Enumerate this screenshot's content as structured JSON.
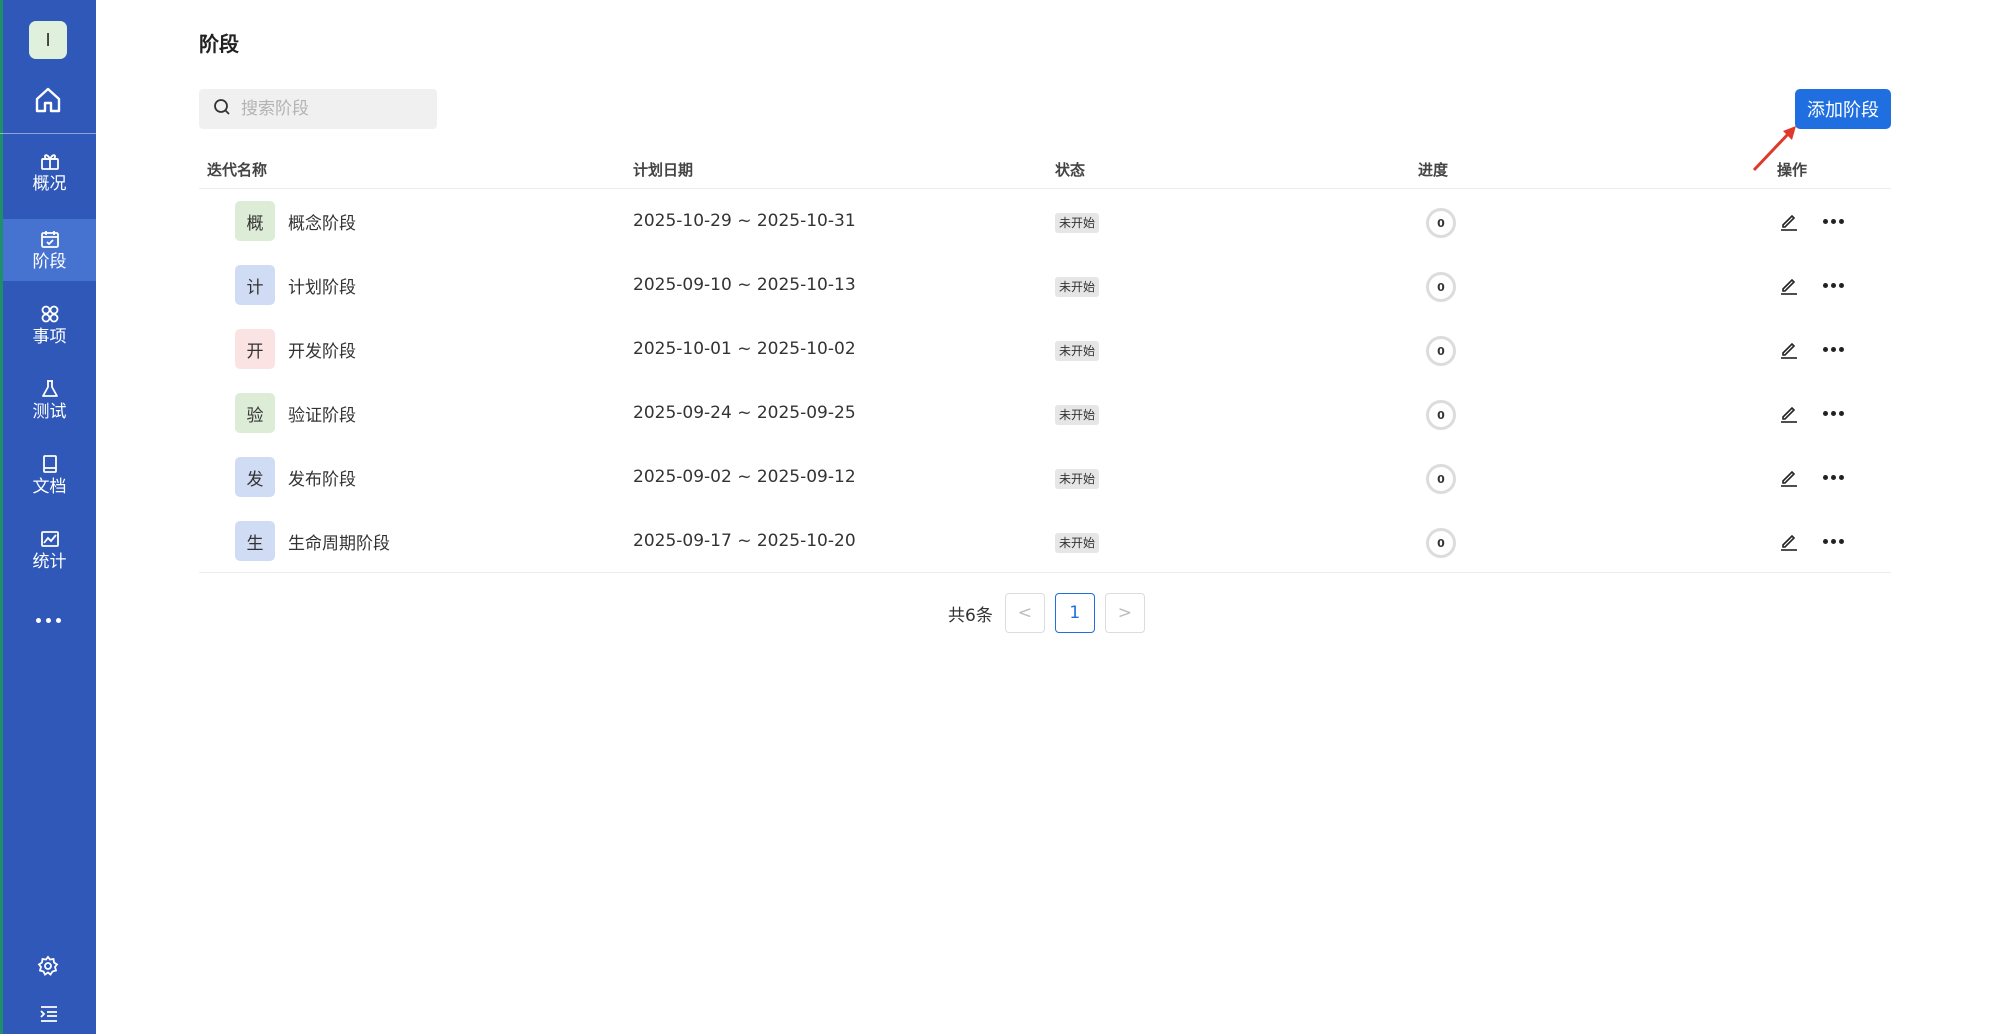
{
  "sidebar": {
    "avatar_letter": "I",
    "items": [
      {
        "label": "概况",
        "icon": "gift-icon",
        "active": false
      },
      {
        "label": "阶段",
        "icon": "calendar-icon",
        "active": true
      },
      {
        "label": "事项",
        "icon": "items-icon",
        "active": false
      },
      {
        "label": "测试",
        "icon": "flask-icon",
        "active": false
      },
      {
        "label": "文档",
        "icon": "book-icon",
        "active": false
      },
      {
        "label": "统计",
        "icon": "chart-icon",
        "active": false
      }
    ]
  },
  "page": {
    "title": "阶段"
  },
  "search": {
    "placeholder": "搜索阶段",
    "value": ""
  },
  "add_button_label": "添加阶段",
  "table": {
    "columns": [
      "迭代名称",
      "计划日期",
      "状态",
      "进度",
      "操作"
    ],
    "rows": [
      {
        "badge": "概",
        "badge_color": "#dcecd6",
        "name": "概念阶段",
        "date": "2025-10-29 ~ 2025-10-31",
        "status": "未开始",
        "progress": "0"
      },
      {
        "badge": "计",
        "badge_color": "#cfdcf3",
        "name": "计划阶段",
        "date": "2025-09-10 ~ 2025-10-13",
        "status": "未开始",
        "progress": "0"
      },
      {
        "badge": "开",
        "badge_color": "#fbe3e3",
        "name": "开发阶段",
        "date": "2025-10-01 ~ 2025-10-02",
        "status": "未开始",
        "progress": "0"
      },
      {
        "badge": "验",
        "badge_color": "#dcecd6",
        "name": "验证阶段",
        "date": "2025-09-24 ~ 2025-09-25",
        "status": "未开始",
        "progress": "0"
      },
      {
        "badge": "发",
        "badge_color": "#cfdcf3",
        "name": "发布阶段",
        "date": "2025-09-02 ~ 2025-09-12",
        "status": "未开始",
        "progress": "0"
      },
      {
        "badge": "生",
        "badge_color": "#cfdcf3",
        "name": "生命周期阶段",
        "date": "2025-09-17 ~ 2025-10-20",
        "status": "未开始",
        "progress": "0"
      }
    ]
  },
  "pagination": {
    "total_text": "共6条",
    "prev": "<",
    "next": ">",
    "current": "1"
  },
  "colors": {
    "sidebar_bg": "#2f58b9",
    "sidebar_active": "#4672d0",
    "primary": "#1f6fe0",
    "annotation_arrow": "#e0392b"
  }
}
